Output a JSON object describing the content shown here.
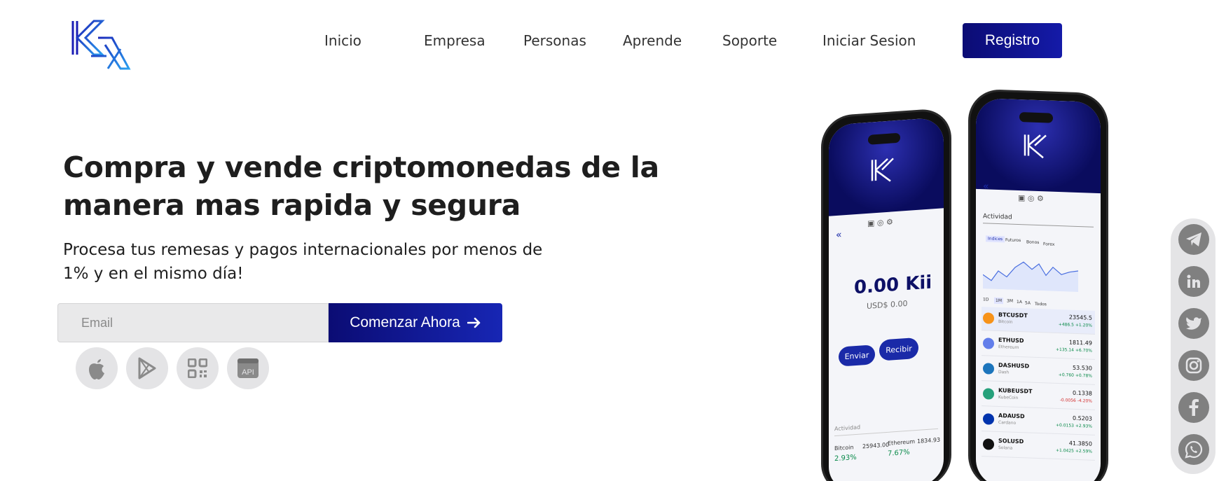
{
  "nav": {
    "items": [
      "Inicio",
      "Empresa",
      "Personas",
      "Aprende",
      "Soporte",
      "Iniciar Sesion"
    ],
    "register": "Registro"
  },
  "hero": {
    "title": "Compra y vende criptomonedas de la manera mas rapida y segura",
    "subtitle": "Procesa tus remesas y pagos internacionales por menos de 1% y en el mismo día!",
    "email_placeholder": "Email",
    "cta": "Comenzar Ahora"
  },
  "store_icons": [
    "apple-icon",
    "google-play-icon",
    "qr-code-icon",
    "api-icon"
  ],
  "api_label": "API",
  "phone_left": {
    "balance": "0.00 Kii",
    "balance_usd": "USD$ 0.00",
    "send": "Enviar",
    "receive": "Recibir",
    "activity": "Actividad",
    "ticker1_name": "Bitcoin",
    "ticker1_price": "25943.00",
    "ticker1_change": "2.93%",
    "ticker2_name": "Ethereum",
    "ticker2_price": "1834.93",
    "ticker2_change": "7.67%"
  },
  "phone_right": {
    "activity": "Actividad",
    "tabs": [
      "Indices",
      "Futuros",
      "Bonos",
      "Forex"
    ],
    "ranges": [
      "1D",
      "1M",
      "3M",
      "1A",
      "5A",
      "Todos"
    ],
    "coins": [
      {
        "symbol": "BTCUSDT",
        "name": "Bitcoin",
        "value": "23545.5",
        "change": "+486.5 +1.20%",
        "color": "#f7931a",
        "up": true
      },
      {
        "symbol": "ETHUSD",
        "name": "Ethereum",
        "value": "1811.49",
        "change": "+135.14 +6.70%",
        "color": "#627eea",
        "up": true
      },
      {
        "symbol": "DASHUSD",
        "name": "Dash",
        "value": "53.530",
        "change": "+0.760 +0.78%",
        "color": "#1c75bc",
        "up": true
      },
      {
        "symbol": "KUBEUSDT",
        "name": "KubeCoin",
        "value": "0.1338",
        "change": "-0.0056 -4.20%",
        "color": "#26a17b",
        "up": false
      },
      {
        "symbol": "ADAUSD",
        "name": "Cardano",
        "value": "0.5203",
        "change": "+0.0153 +2.93%",
        "color": "#0033ad",
        "up": true
      },
      {
        "symbol": "SOLUSD",
        "name": "Solana",
        "value": "41.3850",
        "change": "+1.0425 +2.59%",
        "color": "#111111",
        "up": true
      }
    ]
  },
  "social": [
    "telegram-icon",
    "linkedin-icon",
    "twitter-icon",
    "instagram-icon",
    "facebook-icon",
    "whatsapp-icon"
  ],
  "colors": {
    "brand": "#0b0c74",
    "accent": "#1726b4"
  }
}
